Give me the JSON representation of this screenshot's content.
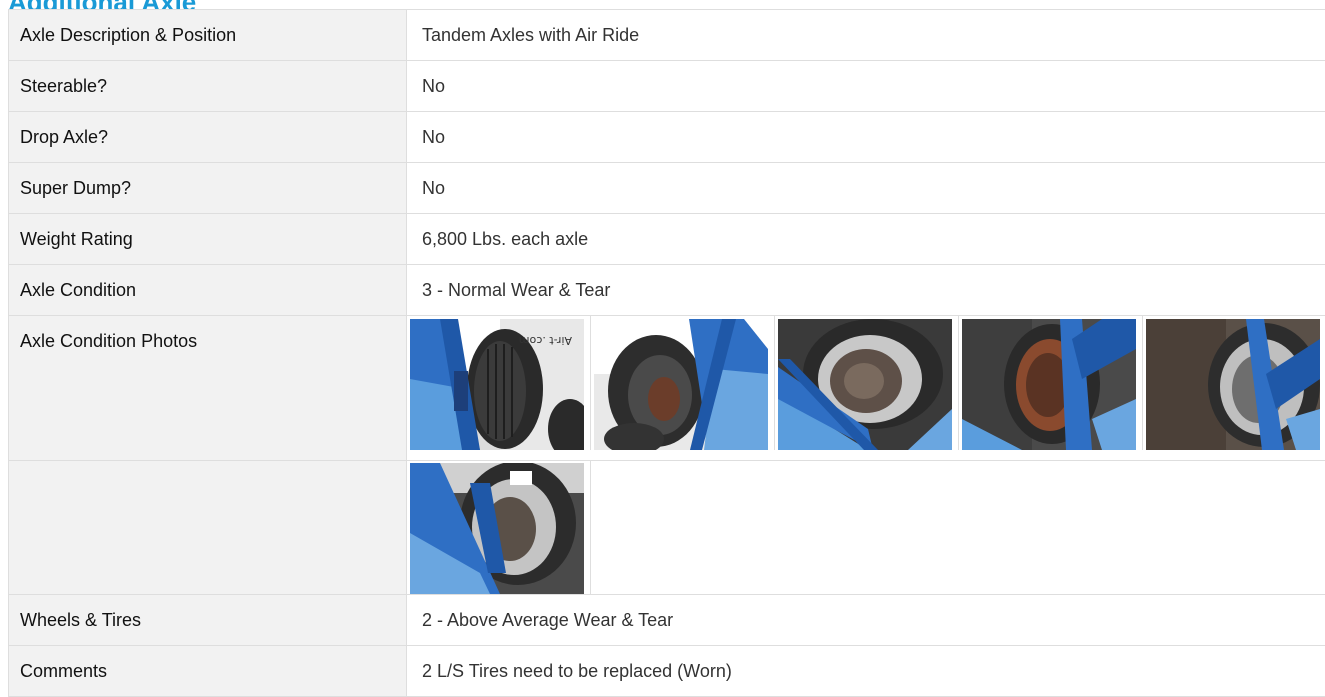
{
  "section": {
    "title": "Additional Axle"
  },
  "rows": [
    {
      "label": "Axle Description & Position",
      "value": "Tandem Axles with Air Ride"
    },
    {
      "label": "Steerable?",
      "value": "No"
    },
    {
      "label": "Drop Axle?",
      "value": "No"
    },
    {
      "label": "Super Dump?",
      "value": "No"
    },
    {
      "label": "Weight Rating",
      "value": "6,800 Lbs. each axle"
    },
    {
      "label": "Axle Condition",
      "value": "3 - Normal Wear & Tear"
    }
  ],
  "photos_row": {
    "label": "Axle Condition Photos",
    "photos": [
      {
        "name": "axle-photo-1",
        "kind": "tire-side-view",
        "text": "Air-t .com"
      },
      {
        "name": "axle-photo-2",
        "kind": "tire-angled"
      },
      {
        "name": "axle-photo-3",
        "kind": "hub-closeup"
      },
      {
        "name": "axle-photo-4",
        "kind": "rusty-hub"
      },
      {
        "name": "axle-photo-5",
        "kind": "hub-angled"
      },
      {
        "name": "axle-photo-6",
        "kind": "hub-lower"
      }
    ]
  },
  "after_rows": [
    {
      "label": "Wheels & Tires",
      "value": "2 - Above Average Wear & Tear"
    },
    {
      "label": "Comments",
      "value": "2 L/S Tires need to be replaced (Worn)"
    }
  ],
  "colors": {
    "title": "#1a9ad6",
    "label_bg": "#f2f2f2",
    "border": "#dedede",
    "trailer_blue": "#2f6fc4"
  }
}
